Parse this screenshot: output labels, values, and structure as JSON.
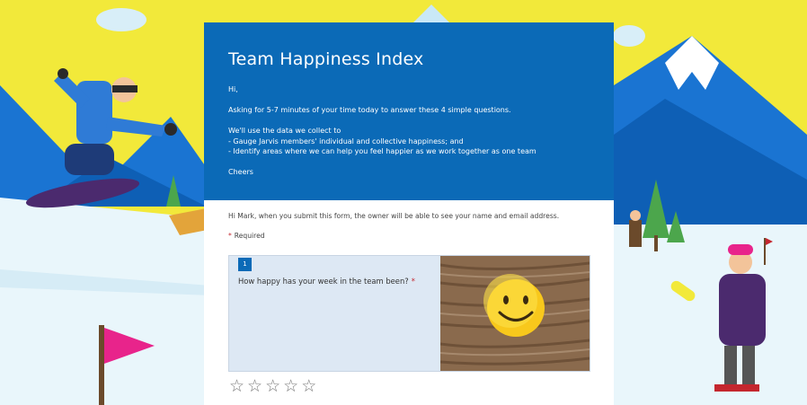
{
  "form": {
    "title": "Team Happiness Index",
    "description": "Hi,\n\nAsking for 5-7 minutes of your time today to answer these 4 simple questions.\n\nWe'll use the data we collect to\n- Gauge Jarvis members' individual and collective happiness; and\n- Identify areas where we can help you feel happier as we work together as one team\n\nCheers",
    "notice": "Hi Mark, when you submit this form, the owner will be able to see your name and email address.",
    "required_star": "*",
    "required_label": "Required"
  },
  "question": {
    "number": "1",
    "text": "How happy has your week in the team been?",
    "required_mark": "*",
    "rating": {
      "max": 5,
      "selected": 0,
      "star_glyph": "☆"
    }
  },
  "colors": {
    "header_blue": "#0b6ab7",
    "sky_yellow": "#f2e93a",
    "snow": "#e9f6fb",
    "mountain_blue": "#1e6fc9",
    "flag_pink": "#e8248b",
    "required_red": "#c4262e"
  },
  "icons": {
    "rating": "star-outline-icon",
    "image": "smiley-face-image"
  }
}
